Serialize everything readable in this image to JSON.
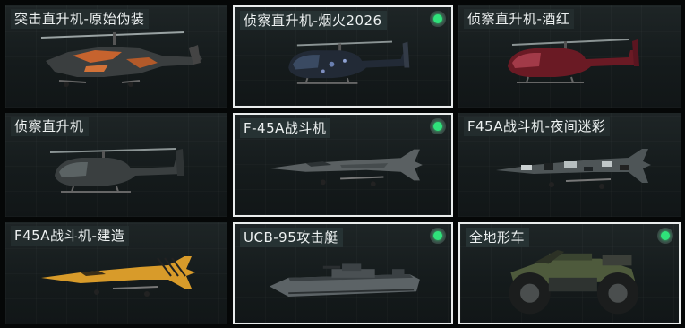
{
  "items": [
    {
      "label": "突击直升机-原始伪装",
      "owned": false,
      "icon": "attack-helicopter-camo"
    },
    {
      "label": "侦察直升机-烟火2026",
      "owned": true,
      "icon": "scout-helicopter-fireworks"
    },
    {
      "label": "侦察直升机-酒红",
      "owned": false,
      "icon": "scout-helicopter-burgundy"
    },
    {
      "label": "侦察直升机",
      "owned": false,
      "icon": "scout-helicopter"
    },
    {
      "label": "F-45A战斗机",
      "owned": true,
      "icon": "fighter-jet"
    },
    {
      "label": "F45A战斗机-夜间迷彩",
      "owned": false,
      "icon": "fighter-jet-night-camo"
    },
    {
      "label": "F45A战斗机-建造",
      "owned": false,
      "icon": "fighter-jet-construction"
    },
    {
      "label": "UCB-95攻击艇",
      "owned": true,
      "icon": "attack-boat"
    },
    {
      "label": "全地形车",
      "owned": true,
      "icon": "atv"
    }
  ],
  "colors": {
    "accent": "#2fe27a",
    "selected_border": "#e9ecec",
    "card_bg": "#1a2021",
    "page_bg": "#050707"
  }
}
